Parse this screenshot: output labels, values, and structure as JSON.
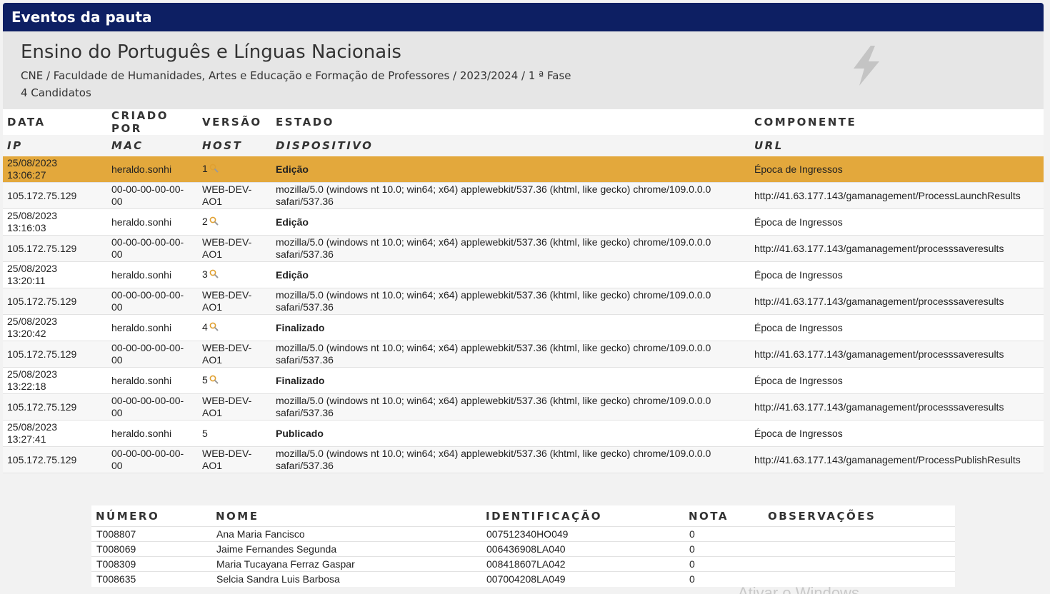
{
  "header": {
    "title": "Eventos da pauta"
  },
  "info": {
    "course": "Ensino do Português e Línguas Nacionais",
    "path": "CNE / Faculdade de Humanidades, Artes e Educação e Formação de Professores / 2023/2024 / 1 ª Fase",
    "count": "4 Candidatos"
  },
  "events": {
    "headers": {
      "date": "DATA",
      "created_by": "CRIADO POR",
      "version": "VERSÃO",
      "state": "ESTADO",
      "component": "COMPONENTE",
      "ip": "IP",
      "mac": "MAC",
      "host": "HOST",
      "device": "DISPOSITIVO",
      "url": "URL"
    },
    "rows": [
      {
        "date": "25/08/2023",
        "time": "13:06:27",
        "user": "heraldo.sonhi",
        "version": "1",
        "state": "Edição",
        "component": "Época de Ingressos",
        "ip": "105.172.75.129",
        "mac1": "00-00-00-00-00-",
        "mac2": "00",
        "host1": "WEB-DEV-",
        "host2": "AO1",
        "device1": "mozilla/5.0 (windows nt 10.0; win64; x64) applewebkit/537.36 (khtml, like gecko) chrome/109.0.0.0",
        "device2": "safari/537.36",
        "url": "http://41.63.177.143/gamanagement/ProcessLaunchResults"
      },
      {
        "date": "25/08/2023",
        "time": "13:16:03",
        "user": "heraldo.sonhi",
        "version": "2",
        "state": "Edição",
        "component": "Época de Ingressos",
        "ip": "105.172.75.129",
        "mac1": "00-00-00-00-00-",
        "mac2": "00",
        "host1": "WEB-DEV-",
        "host2": "AO1",
        "device1": "mozilla/5.0 (windows nt 10.0; win64; x64) applewebkit/537.36 (khtml, like gecko) chrome/109.0.0.0",
        "device2": "safari/537.36",
        "url": "http://41.63.177.143/gamanagement/processsaveresults"
      },
      {
        "date": "25/08/2023",
        "time": "13:20:11",
        "user": "heraldo.sonhi",
        "version": "3",
        "state": "Edição",
        "component": "Época de Ingressos",
        "ip": "105.172.75.129",
        "mac1": "00-00-00-00-00-",
        "mac2": "00",
        "host1": "WEB-DEV-",
        "host2": "AO1",
        "device1": "mozilla/5.0 (windows nt 10.0; win64; x64) applewebkit/537.36 (khtml, like gecko) chrome/109.0.0.0",
        "device2": "safari/537.36",
        "url": "http://41.63.177.143/gamanagement/processsaveresults"
      },
      {
        "date": "25/08/2023",
        "time": "13:20:42",
        "user": "heraldo.sonhi",
        "version": "4",
        "state": "Finalizado",
        "component": "Época de Ingressos",
        "ip": "105.172.75.129",
        "mac1": "00-00-00-00-00-",
        "mac2": "00",
        "host1": "WEB-DEV-",
        "host2": "AO1",
        "device1": "mozilla/5.0 (windows nt 10.0; win64; x64) applewebkit/537.36 (khtml, like gecko) chrome/109.0.0.0",
        "device2": "safari/537.36",
        "url": "http://41.63.177.143/gamanagement/processsaveresults"
      },
      {
        "date": "25/08/2023",
        "time": "13:22:18",
        "user": "heraldo.sonhi",
        "version": "5",
        "state": "Finalizado",
        "component": "Época de Ingressos",
        "ip": "105.172.75.129",
        "mac1": "00-00-00-00-00-",
        "mac2": "00",
        "host1": "WEB-DEV-",
        "host2": "AO1",
        "device1": "mozilla/5.0 (windows nt 10.0; win64; x64) applewebkit/537.36 (khtml, like gecko) chrome/109.0.0.0",
        "device2": "safari/537.36",
        "url": "http://41.63.177.143/gamanagement/processsaveresults"
      },
      {
        "date": "25/08/2023",
        "time": "13:27:41",
        "user": "heraldo.sonhi",
        "version": "5",
        "state": "Publicado",
        "component": "Época de Ingressos",
        "ip": "105.172.75.129",
        "mac1": "00-00-00-00-00-",
        "mac2": "00",
        "host1": "WEB-DEV-",
        "host2": "AO1",
        "device1": "mozilla/5.0 (windows nt 10.0; win64; x64) applewebkit/537.36 (khtml, like gecko) chrome/109.0.0.0",
        "device2": "safari/537.36",
        "url": "http://41.63.177.143/gamanagement/ProcessPublishResults"
      }
    ]
  },
  "candidates": {
    "headers": {
      "number": "NÚMERO",
      "name": "NOME",
      "id": "IDENTIFICAÇÃO",
      "grade": "NOTA",
      "notes": "OBSERVAÇÕES"
    },
    "rows": [
      {
        "number": "T008807",
        "name": "Ana Maria Fancisco",
        "id": "007512340HO049",
        "grade": "0",
        "notes": ""
      },
      {
        "number": "T008069",
        "name": "Jaime Fernandes Segunda",
        "id": "006436908LA040",
        "grade": "0",
        "notes": ""
      },
      {
        "number": "T008309",
        "name": "Maria Tucayana Ferraz Gaspar",
        "id": "008418607LA042",
        "grade": "0",
        "notes": ""
      },
      {
        "number": "T008635",
        "name": "Selcia Sandra Luis Barbosa",
        "id": "007004208LA049",
        "grade": "0",
        "notes": ""
      }
    ]
  },
  "watermark": "Ativar o Windows",
  "colors": {
    "header_bg": "#0d1f63",
    "selected_row": "#e3a83c"
  },
  "icons": {
    "bolt": "lightning-bolt-icon",
    "version_view": "magnifier-icon"
  }
}
